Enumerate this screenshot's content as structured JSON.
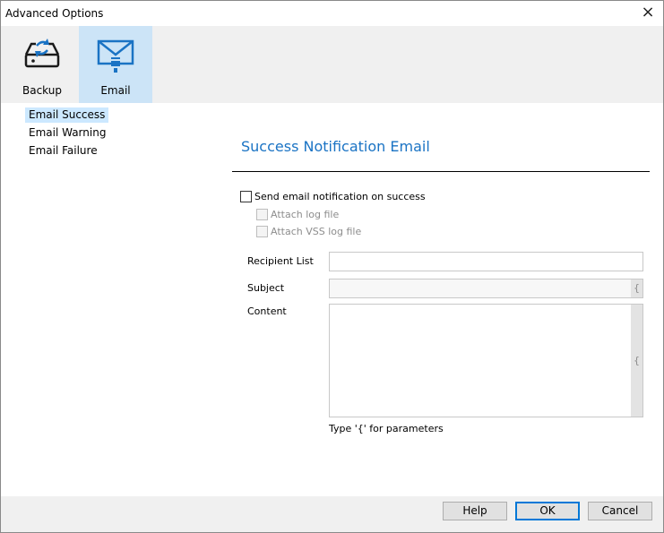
{
  "window": {
    "title": "Advanced Options",
    "close_glyph": "×"
  },
  "toolbar": {
    "items": [
      {
        "label": "Backup",
        "icon": "backup-drive-icon",
        "selected": false
      },
      {
        "label": "Email",
        "icon": "envelope-icon",
        "selected": true
      }
    ]
  },
  "sidebar": {
    "items": [
      {
        "label": "Email Success",
        "selected": true
      },
      {
        "label": "Email Warning",
        "selected": false
      },
      {
        "label": "Email Failure",
        "selected": false
      }
    ]
  },
  "content": {
    "section_title": "Success Notification Email",
    "send_on_success": {
      "label": "Send email notification on success",
      "checked": false
    },
    "attach_log": {
      "label": "Attach log file",
      "checked": false,
      "disabled": true
    },
    "attach_vss_log": {
      "label": "Attach VSS log file",
      "checked": false,
      "disabled": true
    },
    "recipient": {
      "label": "Recipient List",
      "value": ""
    },
    "subject": {
      "label": "Subject",
      "value": "",
      "param_glyph": "{"
    },
    "content_field": {
      "label": "Content",
      "value": "",
      "param_glyph": "{"
    },
    "hint": "Type '{' for parameters"
  },
  "footer": {
    "help_label": "Help",
    "ok_label": "OK",
    "cancel_label": "Cancel"
  },
  "colors": {
    "accent": "#1a73c4",
    "selection": "#cce4f7",
    "primary_border": "#0078d7"
  }
}
